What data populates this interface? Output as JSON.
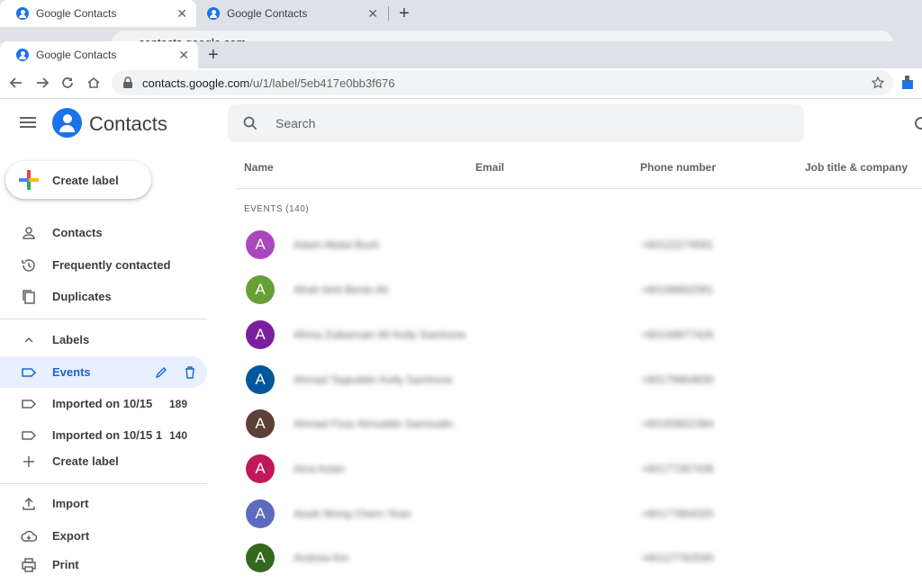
{
  "browser": {
    "back_tabs": [
      {
        "title": "Google Contacts"
      },
      {
        "title": "Google Contacts"
      }
    ],
    "ghost_url": "contacts.google.com",
    "front_tab": {
      "title": "Google Contacts"
    },
    "url_host": "contacts.google.com",
    "url_path": "/u/1/label/5eb417e0bb3f676",
    "new_tab_glyph": "+",
    "close_glyph": "✕"
  },
  "app": {
    "name": "Contacts",
    "create_label": "Create label",
    "nav": [
      {
        "label": "Contacts",
        "icon": "person-icon"
      },
      {
        "label": "Frequently contacted",
        "icon": "history-icon"
      },
      {
        "label": "Duplicates",
        "icon": "copy-icon"
      }
    ],
    "labels_header": "Labels",
    "labels": [
      {
        "label": "Events",
        "count": "",
        "selected": true
      },
      {
        "label": "Imported on 10/15",
        "count": "189"
      },
      {
        "label": "Imported on 10/15 1",
        "count": "140"
      }
    ],
    "bottom_nav": [
      {
        "label": "Import",
        "icon": "upload-icon"
      },
      {
        "label": "Export",
        "icon": "cloud-download-icon"
      },
      {
        "label": "Print",
        "icon": "printer-icon"
      }
    ],
    "search_placeholder": "Search",
    "columns": [
      "Name",
      "Email",
      "Phone number",
      "Job title & company"
    ],
    "section_title": "EVENTS (140)",
    "rows": [
      {
        "initial": "A",
        "color": "#ab47bc",
        "name": "Adam Abdul Bush",
        "phone": "+60122274581"
      },
      {
        "initial": "A",
        "color": "#689f38",
        "name": "Afrah binti Bento Ali",
        "phone": "+60198662081"
      },
      {
        "initial": "A",
        "color": "#7b1fa2",
        "name": "Afrina Zulkarnain 80 Kelly Samhone",
        "phone": "+60149977426"
      },
      {
        "initial": "A",
        "color": "#01579b",
        "name": "Ahmad Taqiuddin Kelly Samhone",
        "phone": "+60179864830"
      },
      {
        "initial": "A",
        "color": "#5d4037",
        "name": "Ahmad Firaz Aimuddin Samsudin",
        "phone": "+60193652364"
      },
      {
        "initial": "A",
        "color": "#c2185b",
        "name": "Aina Azlan",
        "phone": "+60177287438"
      },
      {
        "initial": "A",
        "color": "#5c6bc0",
        "name": "Aisah Wong Chern Yean",
        "phone": "+60177864320"
      },
      {
        "initial": "A",
        "color": "#33691e",
        "name": "Andrew Kin",
        "phone": "+60127762590"
      }
    ]
  }
}
